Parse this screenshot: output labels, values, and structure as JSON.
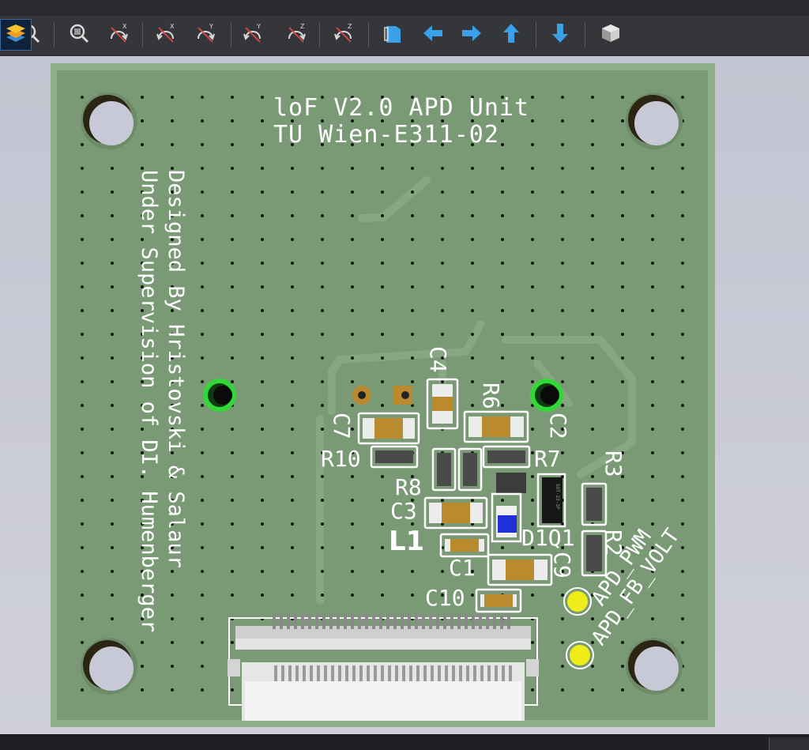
{
  "toolbar": {
    "buttons": [
      {
        "name": "zoom-out-icon",
        "icon": "zoom-out-icon"
      },
      {
        "name": "zoom-to-fit-icon",
        "icon": "zoom-to-fit-icon"
      },
      {
        "name": "rotate-x-clockwise-icon",
        "icon": "rotate-x-clockwise-icon",
        "label": "X"
      },
      {
        "name": "rotate-x-counterclockwise-icon",
        "icon": "rotate-x-counterclockwise-icon",
        "label": "X"
      },
      {
        "name": "rotate-y-clockwise-icon",
        "icon": "rotate-y-clockwise-icon",
        "label": "Y"
      },
      {
        "name": "rotate-y-counterclockwise-icon",
        "icon": "rotate-y-counterclockwise-icon",
        "label": "Y"
      },
      {
        "name": "rotate-z-clockwise-icon",
        "icon": "rotate-z-clockwise-icon",
        "label": "Z"
      },
      {
        "name": "rotate-z-counterclockwise-icon",
        "icon": "rotate-z-counterclockwise-icon",
        "label": "Z"
      },
      {
        "name": "flip-board-icon",
        "icon": "flip-board-icon"
      },
      {
        "name": "move-left-icon",
        "icon": "arrow-left-icon"
      },
      {
        "name": "move-right-icon",
        "icon": "arrow-right-icon"
      },
      {
        "name": "move-up-icon",
        "icon": "arrow-up-icon"
      },
      {
        "name": "move-down-icon",
        "icon": "arrow-down-icon"
      },
      {
        "name": "orthographic-view-icon",
        "icon": "cube-icon"
      },
      {
        "name": "layers-manager-icon",
        "icon": "layers-icon",
        "active": true
      }
    ]
  },
  "board": {
    "colors": {
      "substrate": "#7a9a76",
      "edge": "#8eae89",
      "trace": "#86a782",
      "silkscreen": "#ffffff",
      "copper_pad": "#b98a2e",
      "via_ring": "#1f7a24",
      "via_ring_bright": "#30d838",
      "test_point": "#f0ec1a",
      "diode_blue": "#2030d8"
    },
    "title_line1": "loF V2.0 APD Unit",
    "title_line2": "TU Wien-E311-02",
    "credit_line1": "Designed By Hristovski & Salaur",
    "credit_line2": "Under Supervision of DI. Humenberger",
    "ref_labels": {
      "c4": "C4",
      "r6": "R6",
      "c7": "C7",
      "c2": "C2",
      "r10": "R10",
      "r7": "R7",
      "r3": "R3",
      "r8": "R8",
      "c3": "C3",
      "l1": "L1",
      "d1q1": "D1Q1",
      "r2": "R2",
      "c1": "C1",
      "c9": "C9",
      "c10": "C10"
    },
    "net_labels": {
      "apd_pwm": "APD_PWM",
      "apd_fb_volt": "APD_FB_VOLT"
    },
    "ic_marking": "SOT-23-3P"
  }
}
